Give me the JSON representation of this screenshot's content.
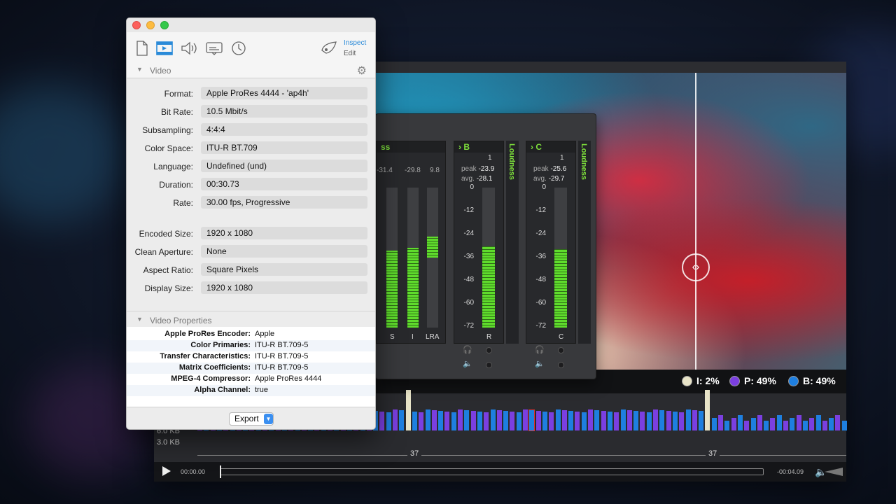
{
  "inspector": {
    "toolbar": {
      "inspect_label": "Inspect",
      "edit_label": "Edit"
    },
    "video_section_title": "Video",
    "video_properties": [
      {
        "label": "Format:",
        "value": "Apple ProRes 4444 - 'ap4h'"
      },
      {
        "label": "Bit Rate:",
        "value": "10.5 Mbit/s"
      },
      {
        "label": "Subsampling:",
        "value": "4:4:4"
      },
      {
        "label": "Color Space:",
        "value": "ITU-R BT.709"
      },
      {
        "label": "Language:",
        "value": "Undefined (und)"
      },
      {
        "label": "Duration:",
        "value": "00:30.73"
      },
      {
        "label": "Rate:",
        "value": "30.00 fps, Progressive"
      }
    ],
    "size_properties": [
      {
        "label": "Encoded Size:",
        "value": "1920 x 1080"
      },
      {
        "label": "Clean Aperture:",
        "value": "None"
      },
      {
        "label": "Aspect Ratio:",
        "value": "Square Pixels"
      },
      {
        "label": "Display Size:",
        "value": "1920 x 1080"
      }
    ],
    "video_properties_section_title": "Video Properties",
    "metadata": [
      {
        "key": "Apple ProRes Encoder:",
        "value": "Apple"
      },
      {
        "key": "Color Primaries:",
        "value": "ITU-R BT.709-5"
      },
      {
        "key": "Transfer Characteristics:",
        "value": "ITU-R BT.709-5"
      },
      {
        "key": "Matrix Coefficients:",
        "value": "ITU-R BT.709-5"
      },
      {
        "key": "MPEG-4 Compressor:",
        "value": "Apple ProRes 4444"
      },
      {
        "key": "Alpha Channel:",
        "value": "true"
      }
    ],
    "export_label": "Export"
  },
  "audio_meters": {
    "partial_channel": {
      "header": "ss",
      "stats": [
        "-31.4",
        "-29.8",
        "9.8"
      ],
      "labels": [
        "S",
        "I",
        "LRA"
      ],
      "fills": [
        0.55,
        0.57,
        0.15
      ]
    },
    "channels": [
      {
        "name": "B",
        "number": "1",
        "peak": "-23.9",
        "avg": "-28.1",
        "bottom_label": "R",
        "fill": 0.58
      },
      {
        "name": "C",
        "number": "1",
        "peak": "-25.6",
        "avg": "-29.7",
        "bottom_label": "C",
        "fill": 0.56
      }
    ],
    "peak_label": "peak",
    "avg_label": "avg.",
    "scale": [
      "0",
      "-12",
      "-24",
      "-36",
      "-48",
      "-60",
      "-72"
    ],
    "loudness_tab_label": "Loudness"
  },
  "viewer": {
    "frame_stats": [
      {
        "label": "I: 2%",
        "color": "#e8e4c8"
      },
      {
        "label": "P: 49%",
        "color": "#7b3fe0"
      },
      {
        "label": "B: 49%",
        "color": "#1e7fe0"
      }
    ],
    "size_axis": [
      "6.0 KB",
      "3.0 KB"
    ],
    "gop_labels": [
      "37",
      "37"
    ],
    "time_current": "00:00.00",
    "time_remaining": "-00:04.09"
  }
}
